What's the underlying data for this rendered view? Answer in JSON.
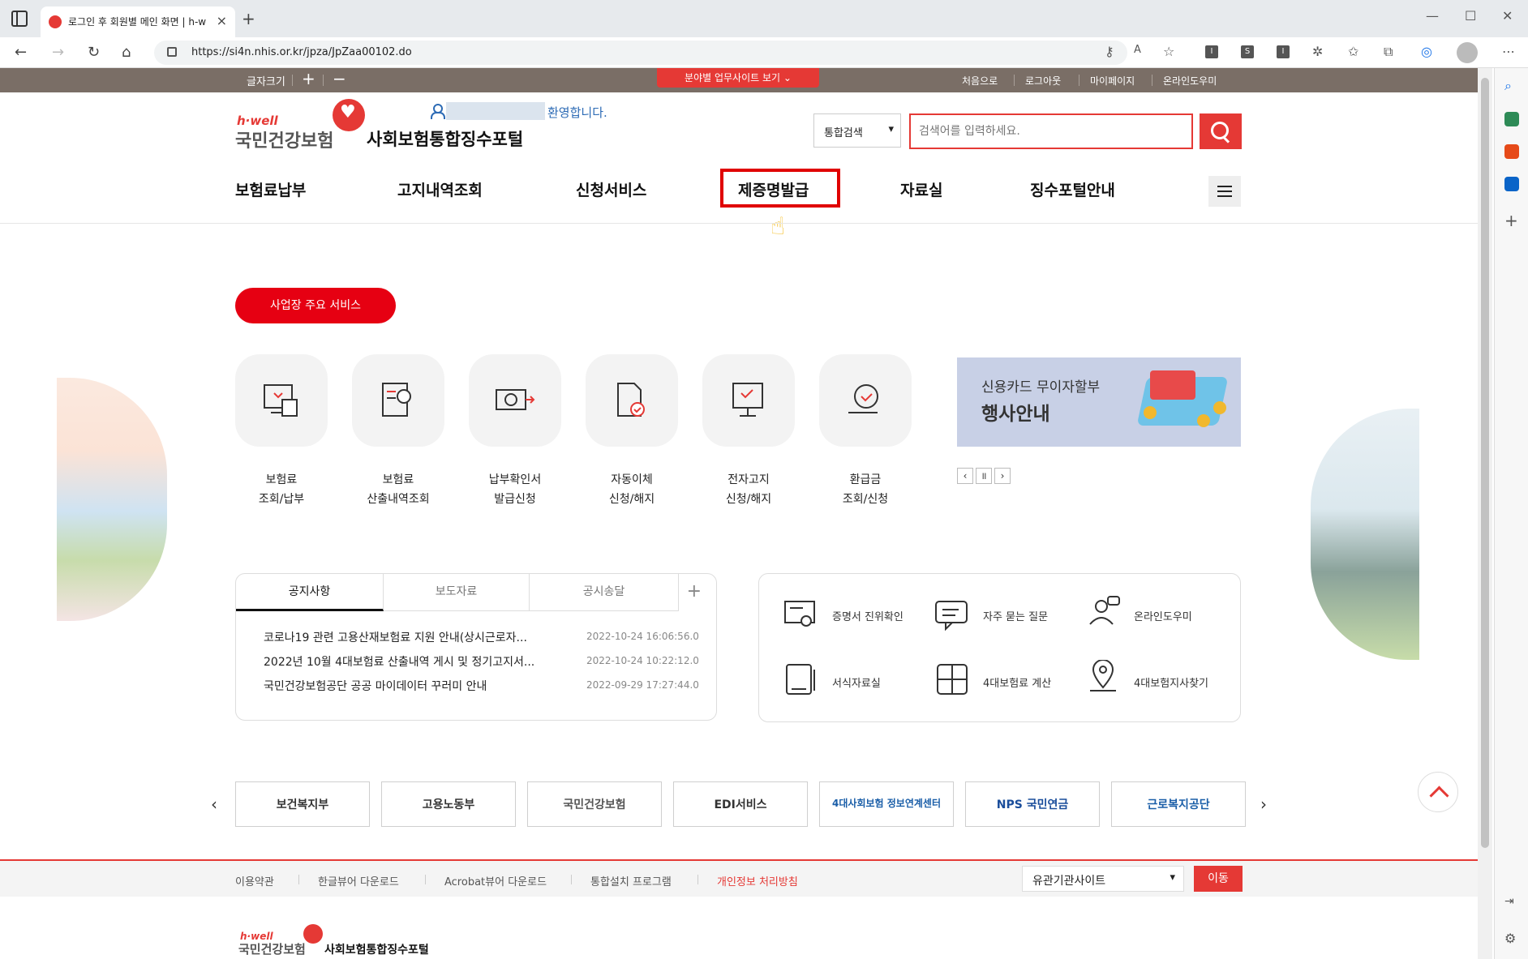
{
  "browser": {
    "tab_title": "로그인 후 회원별 메인 화면 | h-well",
    "url": "https://si4n.nhis.or.kr/jpza/JpZaa00102.do"
  },
  "util": {
    "font_size_label": "글자크기",
    "font_plus": "+",
    "font_minus": "−",
    "biz_sites": "분야별 업무사이트 보기 ⌄",
    "links": [
      "처음으로",
      "로그아웃",
      "마이페이지",
      "온라인도우미"
    ]
  },
  "header": {
    "logo_hwell": "h·well",
    "logo_kr": "국민건강보험",
    "portal_title": "사회보험통합징수포털",
    "welcome": "환영합니다.",
    "search_scope": "통합검색",
    "search_placeholder": "검색어를 입력하세요."
  },
  "gnb": [
    "보험료납부",
    "고지내역조회",
    "신청서비스",
    "제증명발급",
    "자료실",
    "징수포털안내"
  ],
  "gnb_active": "제증명발급",
  "main": {
    "pill": "사업장 주요 서비스",
    "services": [
      {
        "l1": "보험료",
        "l2": "조회/납부"
      },
      {
        "l1": "보험료",
        "l2": "산출내역조회"
      },
      {
        "l1": "납부확인서",
        "l2": "발급신청"
      },
      {
        "l1": "자동이체",
        "l2": "신청/해지"
      },
      {
        "l1": "전자고지",
        "l2": "신청/해지"
      },
      {
        "l1": "환급금",
        "l2": "조회/신청"
      }
    ],
    "banner_line1": "신용카드 무이자할부",
    "banner_line2": "행사안내",
    "banner_prev": "‹",
    "banner_pause": "॥",
    "banner_next": "›"
  },
  "notice": {
    "tabs": [
      "공지사항",
      "보도자료",
      "공시송달"
    ],
    "plus": "+",
    "rows": [
      {
        "title": "코로나19 관련 고용산재보험료 지원 안내(상시근로자...",
        "date": "2022-10-24 16:06:56.0"
      },
      {
        "title": "2022년 10월 4대보험료 산출내역 게시 및 정기고지서...",
        "date": "2022-10-24 10:22:12.0"
      },
      {
        "title": "국민건강보험공단 공공 마이데이터 꾸러미 안내",
        "date": "2022-09-29 17:27:44.0"
      }
    ]
  },
  "quick": [
    "증명서 진위확인",
    "자주 묻는 질문",
    "온라인도우미",
    "서식자료실",
    "4대보험료 계산",
    "4대보험지사찾기"
  ],
  "partners": [
    "보건복지부",
    "고용노동부",
    "국민건강보험",
    "EDI서비스",
    "4대사회보험 정보연계센터",
    "NPS 국민연금",
    "근로복지공단"
  ],
  "partner_prev": "‹",
  "partner_next": "›",
  "footer": {
    "links": [
      "이용약관",
      "한글뷰어 다운로드",
      "Acrobat뷰어 다운로드",
      "통합설치 프로그램",
      "개인정보 처리방침"
    ],
    "related_select": "유관기관사이트",
    "go": "이동",
    "logo_hwell": "h·well",
    "logo_kr": "국민건강보험",
    "title": "사회보험통합징수포털"
  },
  "colors": {
    "brand_red": "#e53935",
    "util_bar": "#7a6e66",
    "privacy_link": "#e53935"
  }
}
